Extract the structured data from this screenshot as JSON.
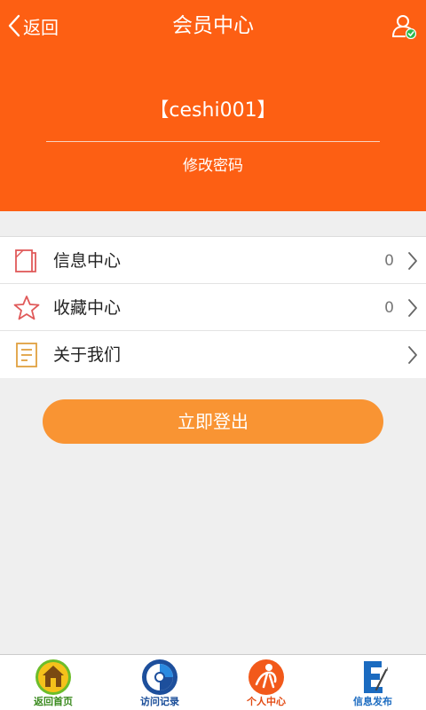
{
  "header": {
    "back_label": "返回",
    "title": "会员中心",
    "username": "【ceshi001】",
    "change_password": "修改密码",
    "accent": "#fd5f13"
  },
  "menu": {
    "items": [
      {
        "label": "信息中心",
        "count": "0",
        "icon": "document-icon"
      },
      {
        "label": "收藏中心",
        "count": "0",
        "icon": "star-icon"
      },
      {
        "label": "关于我们",
        "count": "",
        "icon": "notes-icon"
      }
    ]
  },
  "logout": {
    "label": "立即登出",
    "color": "#f99433"
  },
  "tabbar": {
    "items": [
      {
        "label": "返回首页",
        "icon": "home-icon",
        "color": "#3a8a1e"
      },
      {
        "label": "访问记录",
        "icon": "history-icon",
        "color": "#1c4f9a"
      },
      {
        "label": "个人中心",
        "icon": "person-icon",
        "color": "#e24a12"
      },
      {
        "label": "信息发布",
        "icon": "publish-icon",
        "color": "#1b6bc0"
      }
    ]
  }
}
